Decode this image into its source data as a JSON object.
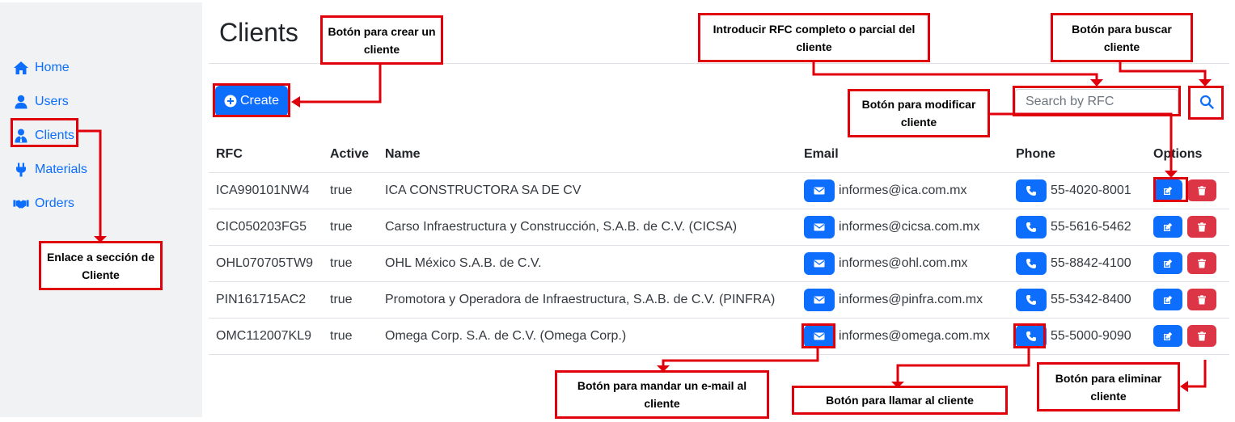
{
  "sidebar": {
    "items": [
      {
        "label": "Home",
        "icon": "home-icon"
      },
      {
        "label": "Users",
        "icon": "user-icon"
      },
      {
        "label": "Clients",
        "icon": "user-tie-icon"
      },
      {
        "label": "Materials",
        "icon": "plug-icon"
      },
      {
        "label": "Orders",
        "icon": "handshake-icon"
      }
    ]
  },
  "header": {
    "title": "Clients"
  },
  "toolbar": {
    "create_label": "Create",
    "search_placeholder": "Search by RFC",
    "search_value": ""
  },
  "table": {
    "columns": [
      "RFC",
      "Active",
      "Name",
      "Email",
      "Phone",
      "Options"
    ],
    "rows": [
      {
        "rfc": "ICA990101NW4",
        "active": "true",
        "name": "ICA CONSTRUCTORA SA DE CV",
        "email": "informes@ica.com.mx",
        "phone": "55-4020-8001"
      },
      {
        "rfc": "CIC050203FG5",
        "active": "true",
        "name": "Carso Infraestructura y Construcción, S.A.B. de C.V. (CICSA)",
        "email": "informes@cicsa.com.mx",
        "phone": "55-5616-5462"
      },
      {
        "rfc": "OHL070705TW9",
        "active": "true",
        "name": "OHL México S.A.B. de C.V.",
        "email": "informes@ohl.com.mx",
        "phone": "55-8842-4100"
      },
      {
        "rfc": "PIN161715AC2",
        "active": "true",
        "name": "Promotora y Operadora de Infraestructura, S.A.B. de C.V. (PINFRA)",
        "email": "informes@pinfra.com.mx",
        "phone": "55-5342-8400"
      },
      {
        "rfc": "OMC112007KL9",
        "active": "true",
        "name": "Omega Corp. S.A. de C.V. (Omega Corp.)",
        "email": "informes@omega.com.mx",
        "phone": "55-5000-9090"
      }
    ]
  },
  "annotations": {
    "create": "Botón para crear un cliente",
    "rfc_input": "Introducir RFC completo o parcial del cliente",
    "search": "Botón para buscar cliente",
    "modify": "Botón para modificar cliente",
    "clients_link": "Enlace a sección de Cliente",
    "email": "Botón para mandar un e-mail al cliente",
    "call": "Botón para llamar al cliente",
    "delete": "Botón para eliminar cliente"
  },
  "colors": {
    "primary": "#0d6efd",
    "danger": "#dc3545",
    "annotation_red": "#e0000b",
    "sidebar_bg": "#f1f2f3"
  }
}
